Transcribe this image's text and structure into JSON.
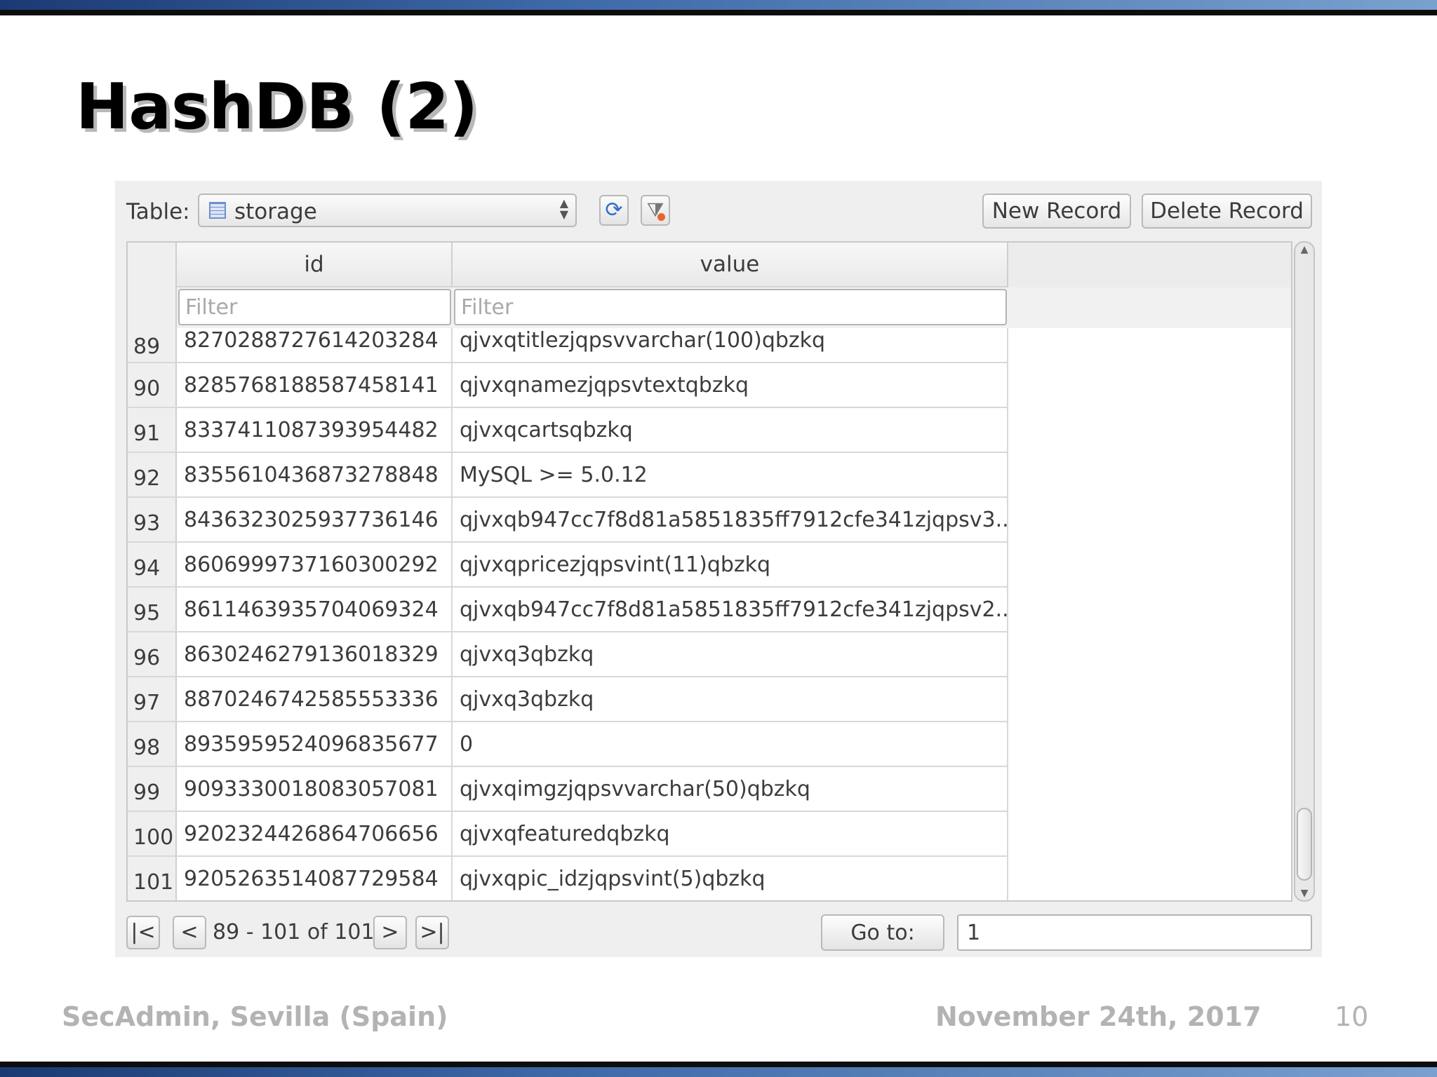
{
  "slide": {
    "title": "HashDB (2)",
    "footer_left": "SecAdmin, Sevilla (Spain)",
    "footer_date": "November 24th, 2017",
    "page_number": "10"
  },
  "toolbar": {
    "table_label": "Table:",
    "table_value": "storage",
    "refresh_icon": "refresh-icon",
    "filter_clear_icon": "clear-filter-icon",
    "new_record_label": "New Record",
    "delete_record_label": "Delete Record"
  },
  "grid": {
    "columns": [
      "id",
      "value"
    ],
    "filter_placeholder": "Filter",
    "rows": [
      {
        "n": "89",
        "id": "8270288727614203284",
        "value": "qjvxqtitlezjqpsvvarchar(100)qbzkq"
      },
      {
        "n": "90",
        "id": "8285768188587458141",
        "value": "qjvxqnamezjqpsvtextqbzkq"
      },
      {
        "n": "91",
        "id": "8337411087393954482",
        "value": "qjvxqcartsqbzkq"
      },
      {
        "n": "92",
        "id": "8355610436873278848",
        "value": "MySQL >= 5.0.12"
      },
      {
        "n": "93",
        "id": "8436323025937736146",
        "value": "qjvxqb947cc7f8d81a5851835ff7912cfe341zjqpsv3..."
      },
      {
        "n": "94",
        "id": "8606999737160300292",
        "value": "qjvxqpricezjqpsvint(11)qbzkq"
      },
      {
        "n": "95",
        "id": "8611463935704069324",
        "value": "qjvxqb947cc7f8d81a5851835ff7912cfe341zjqpsv2..."
      },
      {
        "n": "96",
        "id": "8630246279136018329",
        "value": "qjvxq3qbzkq"
      },
      {
        "n": "97",
        "id": "8870246742585553336",
        "value": "qjvxq3qbzkq"
      },
      {
        "n": "98",
        "id": "8935959524096835677",
        "value": "0"
      },
      {
        "n": "99",
        "id": "9093330018083057081",
        "value": "qjvxqimgzjqpsvvarchar(50)qbzkq"
      },
      {
        "n": "100",
        "id": "9202324426864706656",
        "value": "qjvxqfeaturedqbzkq"
      },
      {
        "n": "101",
        "id": "9205263514087729584",
        "value": "qjvxqpic_idzjqpsvint(5)qbzkq"
      }
    ]
  },
  "pager": {
    "first_label": "|<",
    "prev_label": "<",
    "range_text": "89 - 101 of 101",
    "next_label": ">",
    "last_label": ">|",
    "goto_label": "Go to:",
    "goto_value": "1"
  }
}
